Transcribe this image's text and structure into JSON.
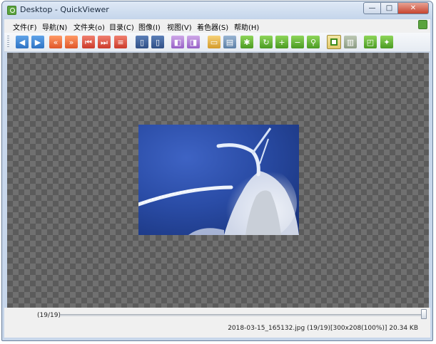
{
  "window": {
    "title": "Desktop - QuickViewer"
  },
  "title_buttons": {
    "minimize": "—",
    "maximize": "□",
    "close": "✕"
  },
  "menu": [
    {
      "label": "文件(F)"
    },
    {
      "label": "导航(N)"
    },
    {
      "label": "文件夹(o)"
    },
    {
      "label": "目录(C)"
    },
    {
      "label": "图像(I)"
    },
    {
      "label": "视图(V)"
    },
    {
      "label": "着色器(S)"
    },
    {
      "label": "帮助(H)"
    }
  ],
  "toolbar": [
    {
      "icon": "prev-image-icon",
      "glyph": "◀",
      "color": "blue"
    },
    {
      "icon": "next-image-icon",
      "glyph": "▶",
      "color": "blue"
    },
    {
      "icon": "fast-back-icon",
      "glyph": "«",
      "color": "orange"
    },
    {
      "icon": "fast-forward-icon",
      "glyph": "»",
      "color": "orange"
    },
    {
      "icon": "first-image-icon",
      "glyph": "⏮",
      "color": "red"
    },
    {
      "icon": "last-image-icon",
      "glyph": "⏭",
      "color": "red"
    },
    {
      "icon": "delete-icon",
      "glyph": "≡",
      "color": "red"
    },
    {
      "icon": "prev-volume-icon",
      "glyph": "▯",
      "color": "navy"
    },
    {
      "icon": "next-volume-icon",
      "glyph": "▯",
      "color": "navy"
    },
    {
      "icon": "page-left-icon",
      "glyph": "◧",
      "color": "purple"
    },
    {
      "icon": "page-right-icon",
      "glyph": "◨",
      "color": "purple"
    },
    {
      "icon": "open-folder-icon",
      "glyph": "▭",
      "color": "gold"
    },
    {
      "icon": "catalog-icon",
      "glyph": "▤",
      "color": "slate"
    },
    {
      "icon": "settings-gear-icon",
      "glyph": "✱",
      "color": "green"
    },
    {
      "icon": "rotate-icon",
      "glyph": "↻",
      "color": "green"
    },
    {
      "icon": "zoom-in-icon",
      "glyph": "+",
      "color": "green"
    },
    {
      "icon": "zoom-out-icon",
      "glyph": "−",
      "color": "green"
    },
    {
      "icon": "zoom-fit-icon",
      "glyph": "⚲",
      "color": "green"
    },
    {
      "icon": "single-page-icon",
      "glyph": "",
      "color": "selected"
    },
    {
      "icon": "dual-page-icon",
      "glyph": "▥",
      "color": "gray"
    },
    {
      "icon": "fullscreen-icon",
      "glyph": "◰",
      "color": "green"
    },
    {
      "icon": "pin-icon",
      "glyph": "✦",
      "color": "green"
    }
  ],
  "viewer": {
    "image": {
      "description_icon": "frosted-tree-photo"
    }
  },
  "bottom": {
    "counter": "(19/19)",
    "slider_position": 1.0,
    "status": "2018-03-15_165132.jpg (19/19)[300x208(100%)] 20.34 KB"
  },
  "colors": {
    "window_frame": "#c7d6ea",
    "close_button": "#c7442f",
    "checker_dark": "#5b5b5b",
    "checker_light": "#707070",
    "sky_blue": "#2a4ca6"
  }
}
